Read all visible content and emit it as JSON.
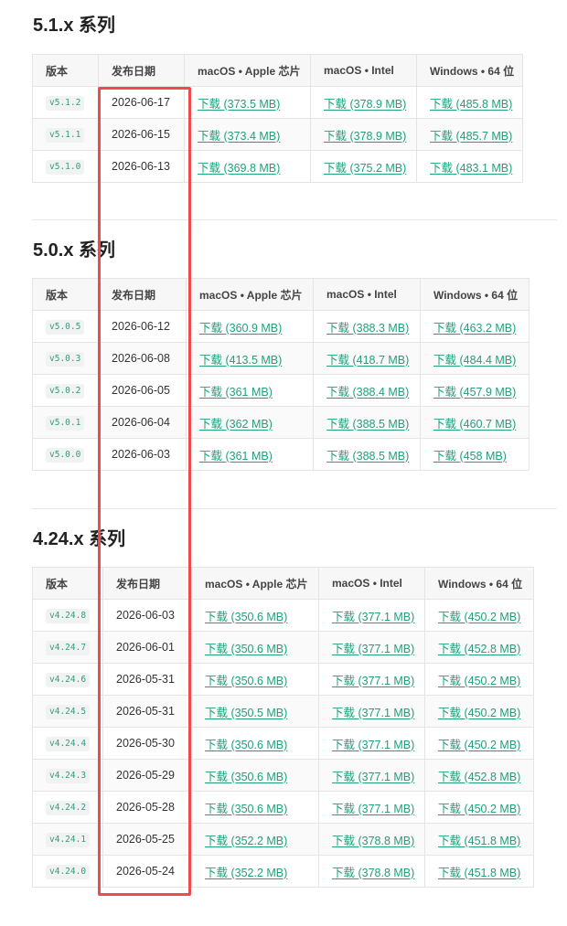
{
  "sections": [
    {
      "title": "5.1.x 系列",
      "headers": [
        "版本",
        "发布日期",
        "macOS • Apple 芯片",
        "macOS • Intel",
        "Windows • 64 位"
      ],
      "rows": [
        {
          "version": "v5.1.2",
          "date": "2026-06-17",
          "mac_arm": "下载 (373.5 MB)",
          "mac_intel": "下载 (378.9 MB)",
          "win": "下载 (485.8 MB)"
        },
        {
          "version": "v5.1.1",
          "date": "2026-06-15",
          "mac_arm": "下载 (373.4 MB)",
          "mac_intel": "下载 (378.9 MB)",
          "win": "下载 (485.7 MB)"
        },
        {
          "version": "v5.1.0",
          "date": "2026-06-13",
          "mac_arm": "下载 (369.8 MB)",
          "mac_intel": "下载 (375.2 MB)",
          "win": "下载 (483.1 MB)"
        }
      ]
    },
    {
      "title": "5.0.x 系列",
      "headers": [
        "版本",
        "发布日期",
        "macOS • Apple 芯片",
        "macOS • Intel",
        "Windows • 64 位"
      ],
      "rows": [
        {
          "version": "v5.0.5",
          "date": "2026-06-12",
          "mac_arm": "下载 (360.9 MB)",
          "mac_intel": "下载 (388.3 MB)",
          "win": "下载 (463.2 MB)"
        },
        {
          "version": "v5.0.3",
          "date": "2026-06-08",
          "mac_arm": "下载 (413.5 MB)",
          "mac_intel": "下载 (418.7 MB)",
          "win": "下载 (484.4 MB)"
        },
        {
          "version": "v5.0.2",
          "date": "2026-06-05",
          "mac_arm": "下载 (361 MB)",
          "mac_intel": "下载 (388.4 MB)",
          "win": "下载 (457.9 MB)"
        },
        {
          "version": "v5.0.1",
          "date": "2026-06-04",
          "mac_arm": "下载 (362 MB)",
          "mac_intel": "下载 (388.5 MB)",
          "win": "下载 (460.7 MB)"
        },
        {
          "version": "v5.0.0",
          "date": "2026-06-03",
          "mac_arm": "下载 (361 MB)",
          "mac_intel": "下载 (388.5 MB)",
          "win": "下载 (458 MB)"
        }
      ]
    },
    {
      "title": "4.24.x 系列",
      "headers": [
        "版本",
        "发布日期",
        "macOS • Apple 芯片",
        "macOS • Intel",
        "Windows • 64 位"
      ],
      "rows": [
        {
          "version": "v4.24.8",
          "date": "2026-06-03",
          "mac_arm": "下载 (350.6 MB)",
          "mac_intel": "下载 (377.1 MB)",
          "win": "下载 (450.2 MB)"
        },
        {
          "version": "v4.24.7",
          "date": "2026-06-01",
          "mac_arm": "下载 (350.6 MB)",
          "mac_intel": "下载 (377.1 MB)",
          "win": "下载 (452.8 MB)"
        },
        {
          "version": "v4.24.6",
          "date": "2026-05-31",
          "mac_arm": "下载 (350.6 MB)",
          "mac_intel": "下载 (377.1 MB)",
          "win": "下载 (450.2 MB)"
        },
        {
          "version": "v4.24.5",
          "date": "2026-05-31",
          "mac_arm": "下载 (350.5 MB)",
          "mac_intel": "下载 (377.1 MB)",
          "win": "下载 (450.2 MB)"
        },
        {
          "version": "v4.24.4",
          "date": "2026-05-30",
          "mac_arm": "下载 (350.6 MB)",
          "mac_intel": "下载 (377.1 MB)",
          "win": "下载 (450.2 MB)"
        },
        {
          "version": "v4.24.3",
          "date": "2026-05-29",
          "mac_arm": "下载 (350.6 MB)",
          "mac_intel": "下载 (377.1 MB)",
          "win": "下载 (452.8 MB)"
        },
        {
          "version": "v4.24.2",
          "date": "2026-05-28",
          "mac_arm": "下载 (350.6 MB)",
          "mac_intel": "下载 (377.1 MB)",
          "win": "下载 (450.2 MB)"
        },
        {
          "version": "v4.24.1",
          "date": "2026-05-25",
          "mac_arm": "下载 (352.2 MB)",
          "mac_intel": "下载 (378.8 MB)",
          "win": "下载 (451.8 MB)"
        },
        {
          "version": "v4.24.0",
          "date": "2026-05-24",
          "mac_arm": "下载 (352.2 MB)",
          "mac_intel": "下载 (378.8 MB)",
          "win": "下载 (451.8 MB)"
        }
      ]
    }
  ],
  "colors": {
    "link": "#21a07a",
    "highlight": "#ef4b4f",
    "border": "#e4e4e4"
  }
}
